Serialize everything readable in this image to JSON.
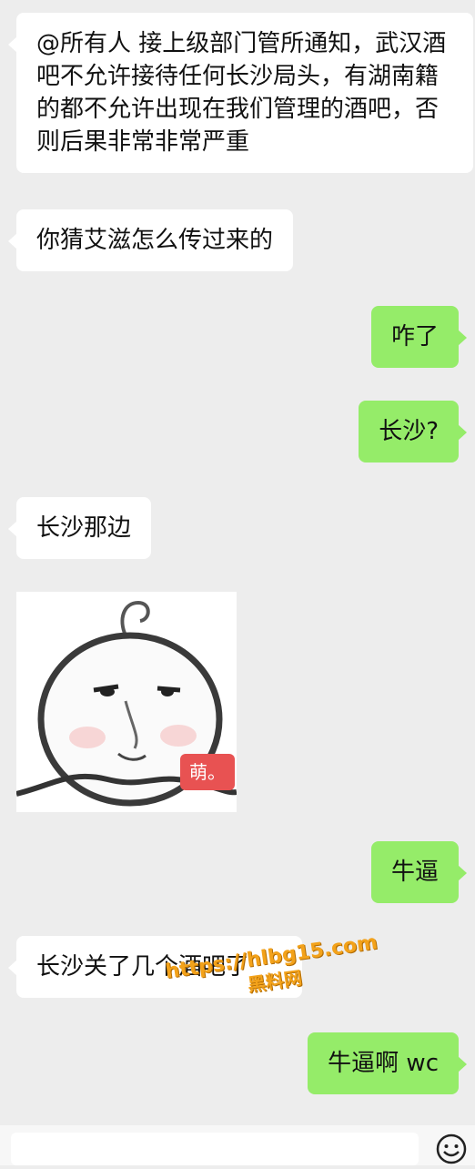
{
  "messages": [
    {
      "side": "in",
      "text": "@所有人 接上级部门管所通知，武汉酒吧不允许接待任何长沙局头，有湖南籍的都不允许出现在我们管理的酒吧，否则后果非常非常严重"
    },
    {
      "side": "in",
      "text": "你猜艾滋怎么传过来的"
    },
    {
      "side": "out",
      "text": "咋了"
    },
    {
      "side": "out",
      "text": "长沙?"
    },
    {
      "side": "in",
      "text": "长沙那边"
    },
    {
      "side": "in",
      "type": "sticker",
      "badge": "萌。"
    },
    {
      "side": "out",
      "text": "牛逼"
    },
    {
      "side": "in",
      "text": "长沙关了几个酒吧了"
    },
    {
      "side": "out",
      "text": "牛逼啊 wc"
    }
  ],
  "watermark": {
    "url": "https://hlbg15.com",
    "name": "黑料网"
  },
  "input_bar": {
    "emoji_icon": "emoji-face-icon"
  },
  "colors": {
    "background": "#ededed",
    "incoming": "#ffffff",
    "outgoing": "#95ec69",
    "badge": "#e85252",
    "watermark": "#f3a21a"
  }
}
